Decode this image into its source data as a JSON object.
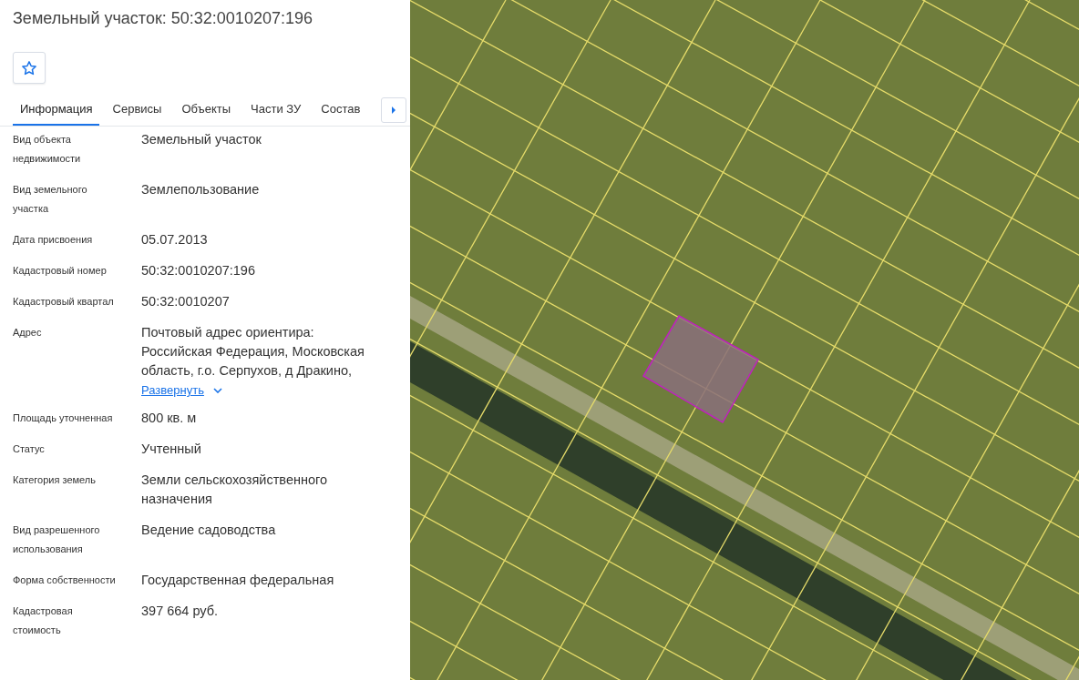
{
  "panel": {
    "title": "Земельный участок: 50:32:0010207:196",
    "favorite": {
      "selected": false
    }
  },
  "tabs": [
    {
      "label": "Информация",
      "selected": true
    },
    {
      "label": "Сервисы",
      "selected": false
    },
    {
      "label": "Объекты",
      "selected": false
    },
    {
      "label": "Части ЗУ",
      "selected": false
    },
    {
      "label": "Состав",
      "selected": false
    }
  ],
  "fields": [
    {
      "label": "Вид объекта недвижимости",
      "value": "Земельный участок"
    },
    {
      "label": "Вид земельного участка",
      "value": "Землепользование"
    },
    {
      "label": "Дата присвоения",
      "value": "05.07.2013"
    },
    {
      "label": "Кадастровый номер",
      "value": "50:32:0010207:196"
    },
    {
      "label": "Кадастровый квартал",
      "value": "50:32:0010207"
    },
    {
      "label": "Адрес",
      "value": "Почтовый адрес ориентира: Российская Федерация, Московская область, г.о. Серпухов, д Дракино,",
      "link": "Развернуть"
    },
    {
      "label": "Площадь уточненная",
      "value": "800 кв. м"
    },
    {
      "label": "Статус",
      "value": "Учтенный"
    },
    {
      "label": "Категория земель",
      "value": "Земли сельскохозяйственного назначения"
    },
    {
      "label": "Вид разрешенного использования",
      "value": "Ведение садоводства"
    },
    {
      "label": "Форма собственности",
      "value": "Государственная федеральная"
    },
    {
      "label": "Кадастровая стоимость",
      "value": "397 664 руб."
    }
  ]
}
